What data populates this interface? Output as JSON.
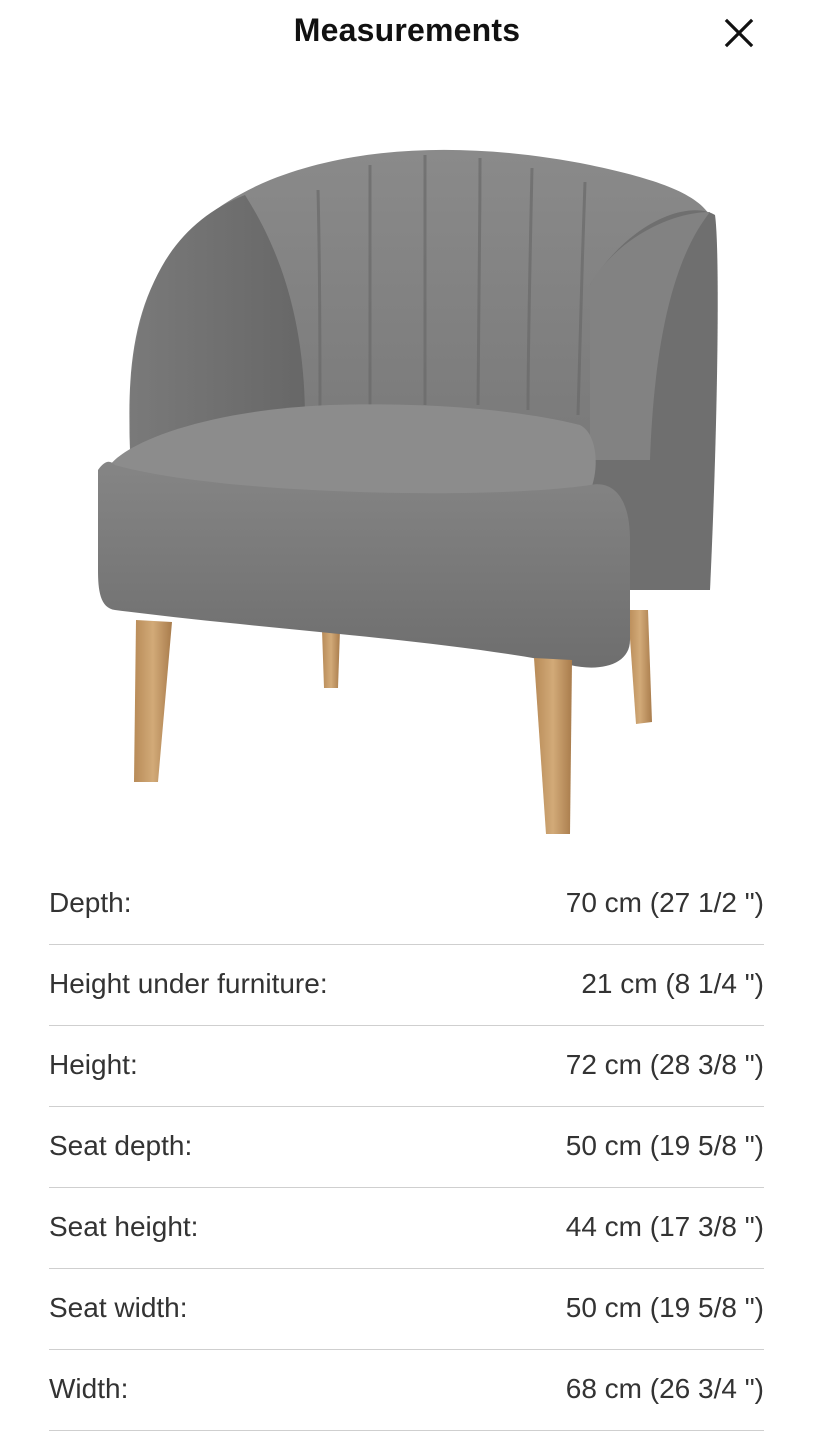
{
  "header": {
    "title": "Measurements",
    "close_icon": "close-icon"
  },
  "product": {
    "image": "armchair-image"
  },
  "measurements": [
    {
      "label": "Depth:",
      "value": "70 cm (27 1/2 \")"
    },
    {
      "label": "Height under furniture:",
      "value": "21 cm (8 1/4 \")"
    },
    {
      "label": "Height:",
      "value": "72 cm (28 3/8 \")"
    },
    {
      "label": "Seat depth:",
      "value": "50 cm (19 5/8 \")"
    },
    {
      "label": "Seat height:",
      "value": "44 cm (17 3/8 \")"
    },
    {
      "label": "Seat width:",
      "value": "50 cm (19 5/8 \")"
    },
    {
      "label": "Width:",
      "value": "68 cm (26 3/4 \")"
    }
  ],
  "colors": {
    "fabric": "#7a7a7a",
    "wood": "#c49a68",
    "divider": "#cfcfcf",
    "text": "#333333"
  }
}
